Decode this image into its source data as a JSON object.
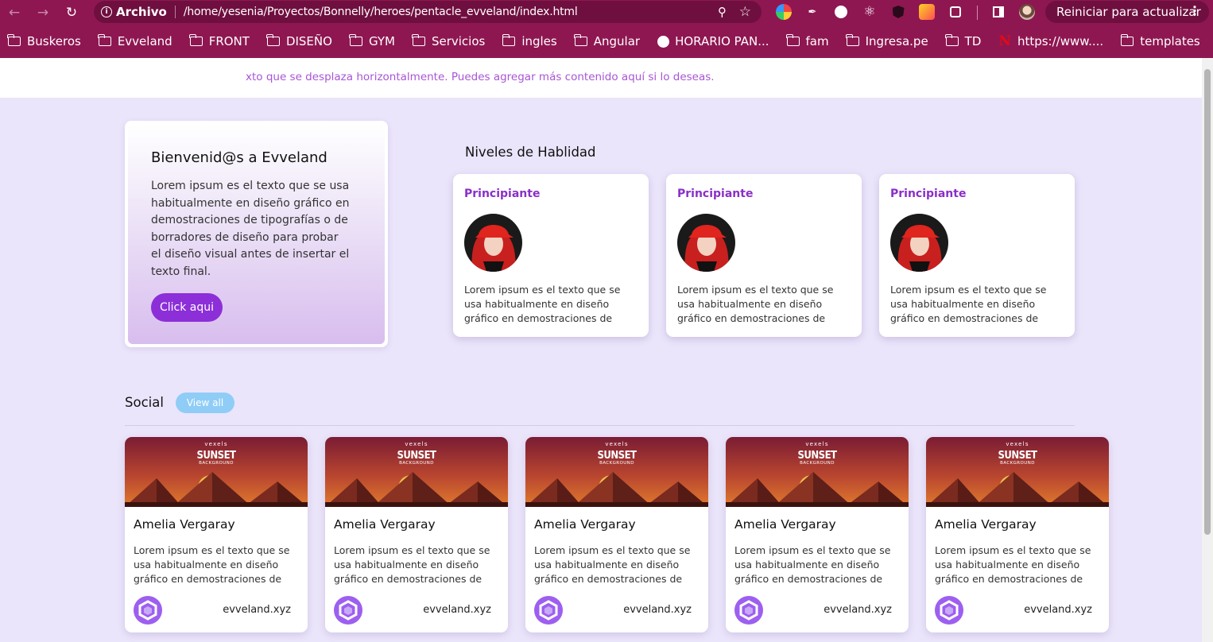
{
  "browser": {
    "back_icon": "arrow-left-icon",
    "forward_icon": "arrow-right-icon",
    "reload_icon": "reload-icon",
    "scheme_label": "Archivo",
    "url": "/home/yesenia/Proyectos/Bonnelly/heroes/pentacle_evveland/index.html",
    "update_label": "Reiniciar para actualizar",
    "bookmarks": [
      {
        "label": "Buskeros",
        "icon": "folder-icon"
      },
      {
        "label": "Evveland",
        "icon": "folder-icon"
      },
      {
        "label": "FRONT",
        "icon": "folder-icon"
      },
      {
        "label": "DISEÑO",
        "icon": "folder-icon"
      },
      {
        "label": "GYM",
        "icon": "folder-icon"
      },
      {
        "label": "Servicios",
        "icon": "folder-icon"
      },
      {
        "label": "ingles",
        "icon": "folder-icon"
      },
      {
        "label": "Angular",
        "icon": "folder-icon"
      },
      {
        "label": "HORARIO PAN...",
        "icon": "globe-icon"
      },
      {
        "label": "fam",
        "icon": "folder-icon"
      },
      {
        "label": "Ingresa.pe",
        "icon": "folder-icon"
      },
      {
        "label": "TD",
        "icon": "folder-icon"
      },
      {
        "label": "https://www....",
        "icon": "netflix-icon"
      },
      {
        "label": "templates",
        "icon": "folder-icon"
      }
    ]
  },
  "marquee": {
    "text": "xto que se desplaza horizontalmente. Puedes agregar más contenido aquí si lo deseas."
  },
  "welcome": {
    "title": "Bienvenid@s a Evveland",
    "body": "Lorem ipsum es el texto que se usa habitualmente en diseño gráfico en demostraciones de tipografías o de borradores de diseño para probar el diseño visual antes de insertar el texto final.",
    "button_label": "Click aqui"
  },
  "skills": {
    "title": "Niveles de Hablidad",
    "items": [
      {
        "level": "Principiante",
        "desc": "Lorem ipsum es el texto que se usa habitualmente en diseño gráfico en demostraciones de tipografías o de..."
      },
      {
        "level": "Principiante",
        "desc": "Lorem ipsum es el texto que se usa habitualmente en diseño gráfico en demostraciones de tipografías o de..."
      },
      {
        "level": "Principiante",
        "desc": "Lorem ipsum es el texto que se usa habitualmente en diseño gráfico en demostraciones de tipografías o de..."
      }
    ]
  },
  "social": {
    "title": "Social",
    "view_all_label": "View all",
    "cards": [
      {
        "brand": "vexels",
        "banner_title": "SUNSET",
        "banner_sub": "BACKGROUND",
        "name": "Amelia Vergaray",
        "desc": "Lorem ipsum es el texto que se usa habitualmente en diseño gráfico en demostraciones de tipografías o d...",
        "site": "evveland.xyz"
      },
      {
        "brand": "vexels",
        "banner_title": "SUNSET",
        "banner_sub": "BACKGROUND",
        "name": "Amelia Vergaray",
        "desc": "Lorem ipsum es el texto que se usa habitualmente en diseño gráfico en demostraciones de tipografías o d...",
        "site": "evveland.xyz"
      },
      {
        "brand": "vexels",
        "banner_title": "SUNSET",
        "banner_sub": "BACKGROUND",
        "name": "Amelia Vergaray",
        "desc": "Lorem ipsum es el texto que se usa habitualmente en diseño gráfico en demostraciones de tipografías o d...",
        "site": "evveland.xyz"
      },
      {
        "brand": "vexels",
        "banner_title": "SUNSET",
        "banner_sub": "BACKGROUND",
        "name": "Amelia Vergaray",
        "desc": "Lorem ipsum es el texto que se usa habitualmente en diseño gráfico en demostraciones de tipografías o d...",
        "site": "evveland.xyz"
      },
      {
        "brand": "vexels",
        "banner_title": "SUNSET",
        "banner_sub": "BACKGROUND",
        "name": "Amelia Vergaray",
        "desc": "Lorem ipsum es el texto que se usa habitualmente en diseño gráfico en demostraciones de tipografías o d...",
        "site": "evveland.xyz"
      }
    ]
  },
  "colors": {
    "chrome": "#8e1752",
    "page_bg": "#ebe5fb",
    "accent_purple": "#8c2fd8",
    "view_all_blue": "#8fcdf7"
  }
}
